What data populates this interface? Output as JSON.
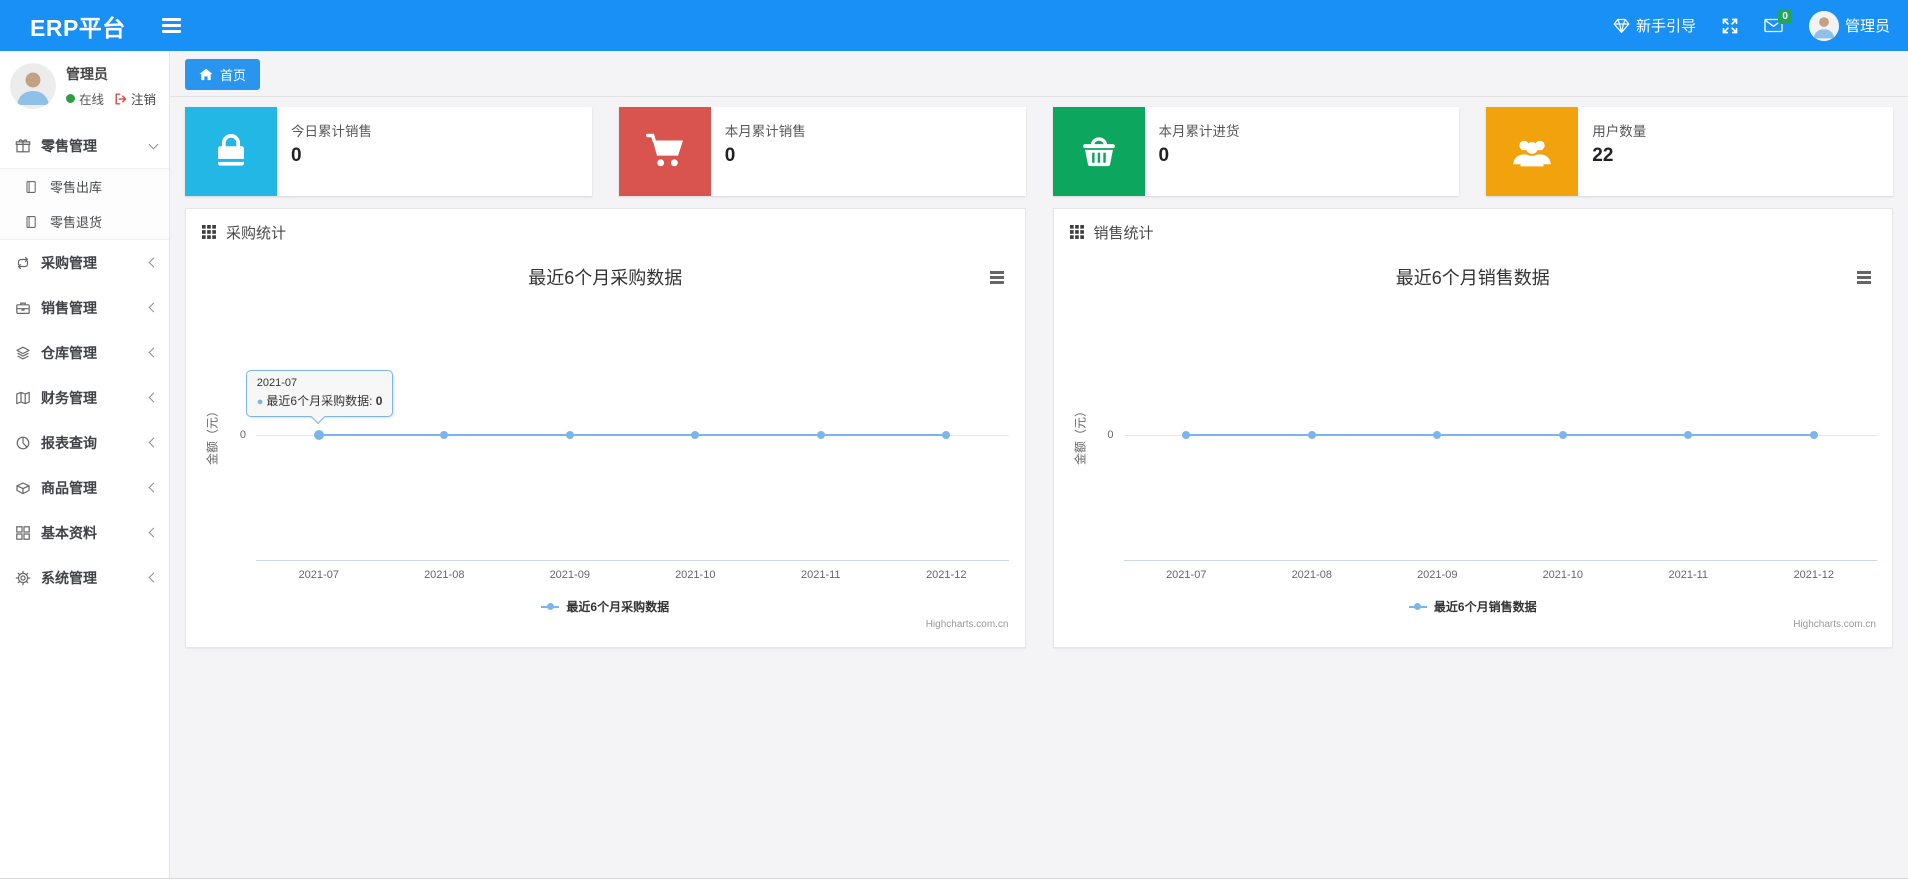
{
  "navbar": {
    "brand": "ERP平台",
    "guide_label": "新手引导",
    "mail_badge": "0",
    "user_name": "管理员"
  },
  "sidebar": {
    "user": {
      "name": "管理员",
      "status": "在线",
      "logout": "注销"
    },
    "items": [
      {
        "label": "零售管理",
        "icon": "gift-icon",
        "state": "expanded"
      },
      {
        "label": "零售出库",
        "icon": "journal-icon",
        "sub": true
      },
      {
        "label": "零售退货",
        "icon": "journal-icon",
        "sub": true
      },
      {
        "label": "采购管理",
        "icon": "repeat-icon",
        "state": "collapsed"
      },
      {
        "label": "销售管理",
        "icon": "briefcase-icon",
        "state": "collapsed"
      },
      {
        "label": "仓库管理",
        "icon": "layers-icon",
        "state": "collapsed"
      },
      {
        "label": "财务管理",
        "icon": "ledger-icon",
        "state": "collapsed"
      },
      {
        "label": "报表查询",
        "icon": "pie-icon",
        "state": "collapsed"
      },
      {
        "label": "商品管理",
        "icon": "box-icon",
        "state": "collapsed"
      },
      {
        "label": "基本资料",
        "icon": "grid-icon",
        "state": "collapsed"
      },
      {
        "label": "系统管理",
        "icon": "gear-icon",
        "state": "collapsed"
      }
    ]
  },
  "tabs": [
    {
      "label": "首页",
      "active": true
    }
  ],
  "cards": [
    {
      "title": "今日累计销售",
      "value": "0",
      "color": "#23b7e5",
      "icon": "shopping-bag-icon"
    },
    {
      "title": "本月累计销售",
      "value": "0",
      "color": "#d9534f",
      "icon": "cart-icon"
    },
    {
      "title": "本月累计进货",
      "value": "0",
      "color": "#0ca65e",
      "icon": "basket-icon"
    },
    {
      "title": "用户数量",
      "value": "22",
      "color": "#f2a20d",
      "icon": "users-icon"
    }
  ],
  "panels": [
    {
      "header": "采购统计"
    },
    {
      "header": "销售统计"
    }
  ],
  "chart_data": [
    {
      "type": "line",
      "title": "最近6个月采购数据",
      "x": [
        "2021-07",
        "2021-08",
        "2021-09",
        "2021-10",
        "2021-11",
        "2021-12"
      ],
      "series": [
        {
          "name": "最近6个月采购数据",
          "values": [
            0,
            0,
            0,
            0,
            0,
            0
          ]
        }
      ],
      "ylabel": "金额（元）",
      "yticks": [
        "0"
      ],
      "ylim": [
        -1,
        1
      ],
      "grid": true,
      "line_color": "#7cb5ec",
      "legend_position": "bottom",
      "credit": "Highcharts.com.cn",
      "tooltip": {
        "visible": true,
        "x": "2021-07",
        "series": "最近6个月采购数据",
        "value": "0"
      }
    },
    {
      "type": "line",
      "title": "最近6个月销售数据",
      "x": [
        "2021-07",
        "2021-08",
        "2021-09",
        "2021-10",
        "2021-11",
        "2021-12"
      ],
      "series": [
        {
          "name": "最近6个月销售数据",
          "values": [
            0,
            0,
            0,
            0,
            0,
            0
          ]
        }
      ],
      "ylabel": "金额（元）",
      "yticks": [
        "0"
      ],
      "ylim": [
        -1,
        1
      ],
      "grid": true,
      "line_color": "#7cb5ec",
      "legend_position": "bottom",
      "credit": "Highcharts.com.cn",
      "tooltip": {
        "visible": false
      }
    }
  ]
}
